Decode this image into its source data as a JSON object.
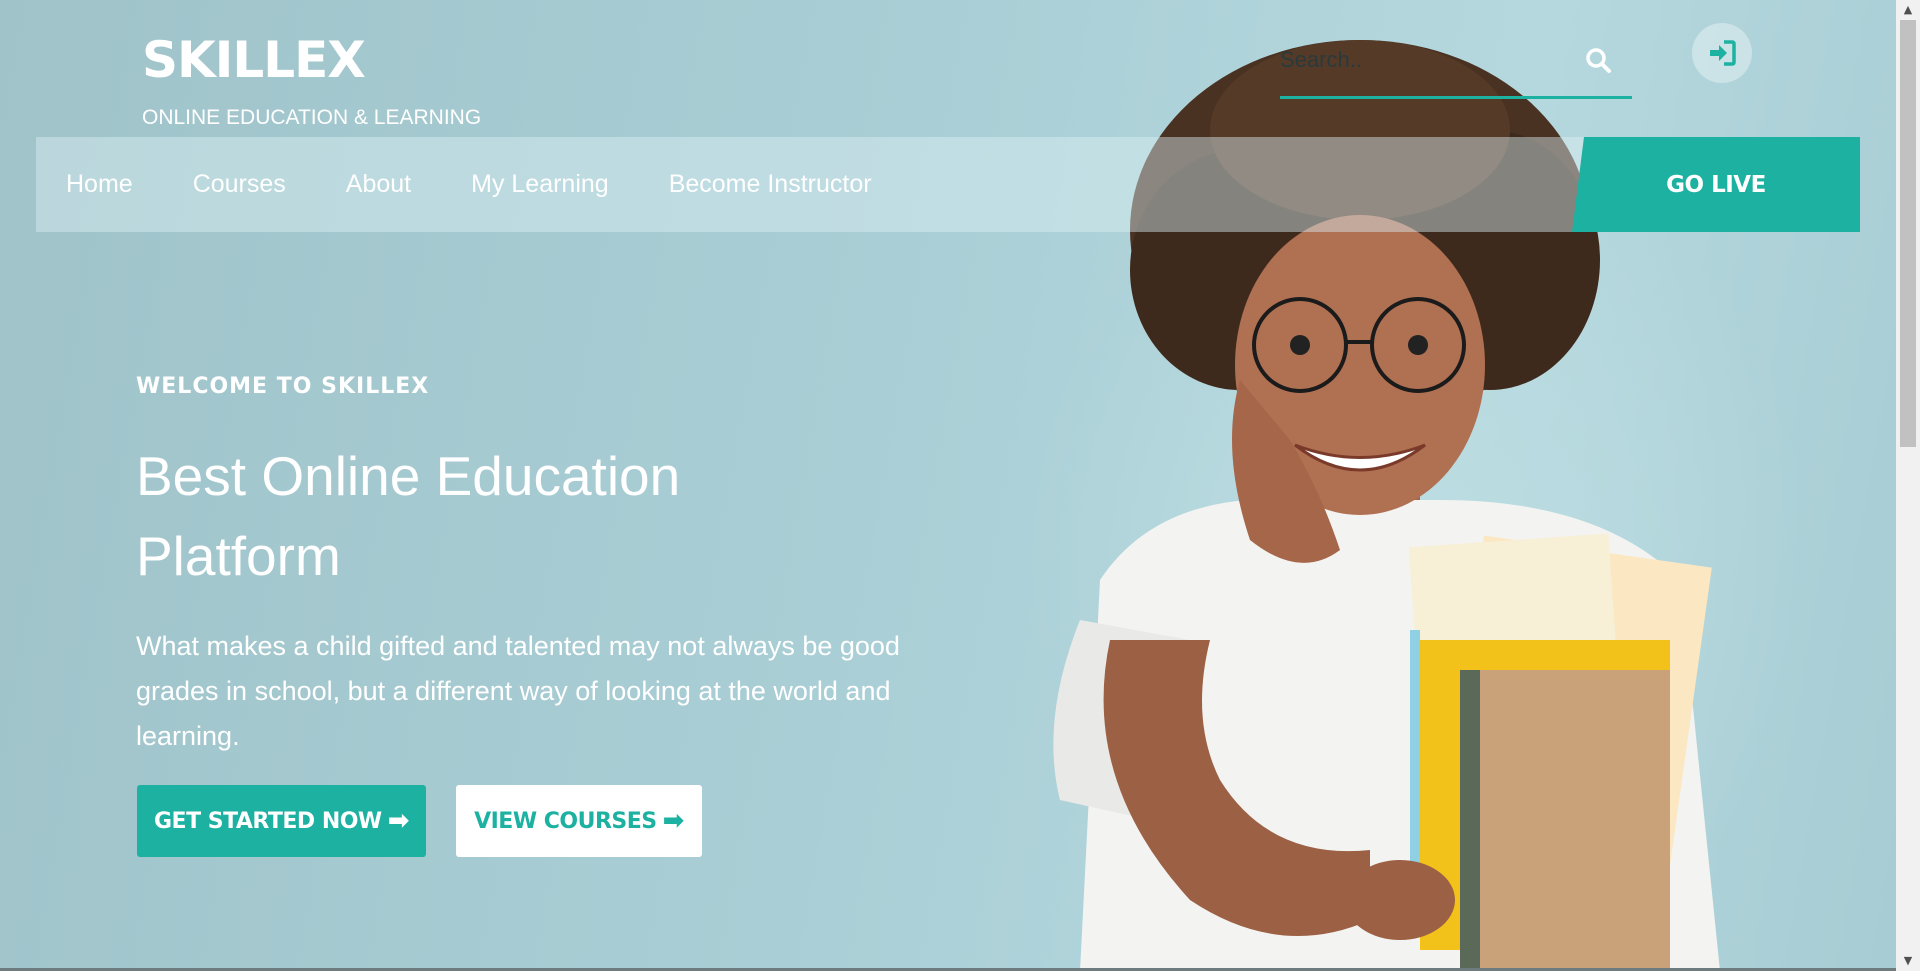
{
  "brand": {
    "name": "SKILLEX",
    "tagline": "ONLINE EDUCATION & LEARNING"
  },
  "search": {
    "placeholder": "Search..",
    "icon": "search-icon"
  },
  "login": {
    "icon": "sign-in-icon"
  },
  "nav": {
    "items": [
      {
        "label": "Home"
      },
      {
        "label": "Courses"
      },
      {
        "label": "About"
      },
      {
        "label": "My Learning"
      },
      {
        "label": "Become Instructor"
      }
    ],
    "cta": "GO LIVE"
  },
  "hero": {
    "eyebrow": "WELCOME TO SKILLEX",
    "headline": "Best Online Education Platform",
    "description": "What makes a child gifted and talented may not always be good grades in school, but a different way of looking at the world and learning.",
    "primary_button": "GET STARTED NOW",
    "secondary_button": "VIEW COURSES",
    "arrow_icon": "arrow-right-icon"
  },
  "colors": {
    "accent": "#1db1a2",
    "background": "#a6cbd2"
  }
}
